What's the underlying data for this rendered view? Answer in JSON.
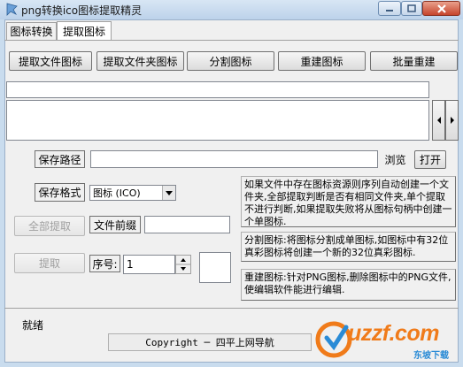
{
  "window": {
    "title": "png转换ico图标提取精灵"
  },
  "tabs": [
    {
      "label": "图标转换"
    },
    {
      "label": "提取图标"
    }
  ],
  "toolbar": {
    "extract_file_icon": "提取文件图标",
    "extract_folder_icon": "提取文件夹图标",
    "split_icon": "分割图标",
    "rebuild_icon": "重建图标",
    "batch_rebuild": "批量重建"
  },
  "save_path": {
    "label": "保存路径",
    "value": "",
    "browse": "浏览",
    "open": "打开"
  },
  "save_format": {
    "label": "保存格式",
    "selected": "图标 (ICO)"
  },
  "actions": {
    "extract_all": "全部提取",
    "extract": "提取"
  },
  "file_prefix": {
    "label": "文件前缀",
    "value": ""
  },
  "index": {
    "label": "序号:",
    "value": "1"
  },
  "notes": {
    "extract": "如果文件中存在图标资源则序列自动创建一个文件夹,全部提取判断是否有相同文件夹,单个提取不进行判断,如果提取失败将从图标句柄中创建一个单图标.",
    "split": "分割图标:将图标分割成单图标,如图标中有32位真彩图标将创建一个新的32位真彩图标.",
    "rebuild": "重建图标:针对PNG图标,删除图标中的PNG文件,使编辑软件能进行编辑."
  },
  "status": {
    "text": "就绪"
  },
  "footer": {
    "copyright": "Copyright ─ 四平上网导航"
  },
  "watermark": {
    "text": "uzzf.com",
    "subtext": "东坡下载"
  },
  "colors": {
    "titlebar": "#c9dcee",
    "client": "#f0f0f0",
    "close": "#c6452c",
    "watermark": "#f07b1a"
  }
}
